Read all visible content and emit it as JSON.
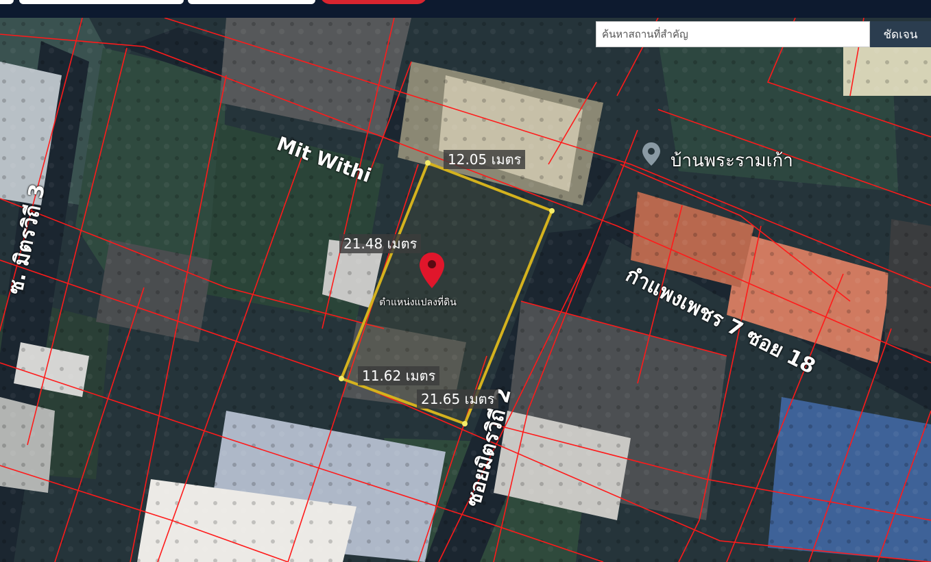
{
  "search": {
    "placeholder": "ค้นหาสถานที่สำคัญ",
    "button_label": "ชัดเจน"
  },
  "plot": {
    "pin_label": "ตำแหน่งแปลงที่ดิน",
    "measurements": {
      "top": "12.05 เมตร",
      "left": "21.48 เมตร",
      "bottom": "11.62 เมตร",
      "right": "21.65 เมตร"
    },
    "outline_color": "#d4b21e",
    "pin_color": "#e0162b"
  },
  "poi": {
    "name": "บ้านพระรามเก้า",
    "icon": "place-pin-icon"
  },
  "roads": {
    "mit_withi": "Mit Withi",
    "mit_withi_3": "ซ. มิตรวิถี 3",
    "mit_withi_2": "ซอยมิตรวิถี 2",
    "kamphaeng_phet": "กำแพงเพชร 7 ซอย 18"
  },
  "colors": {
    "parcel_lines": "#ff1a1a",
    "topbar": "#0d1a2f",
    "search_button": "#2b3d4f"
  }
}
